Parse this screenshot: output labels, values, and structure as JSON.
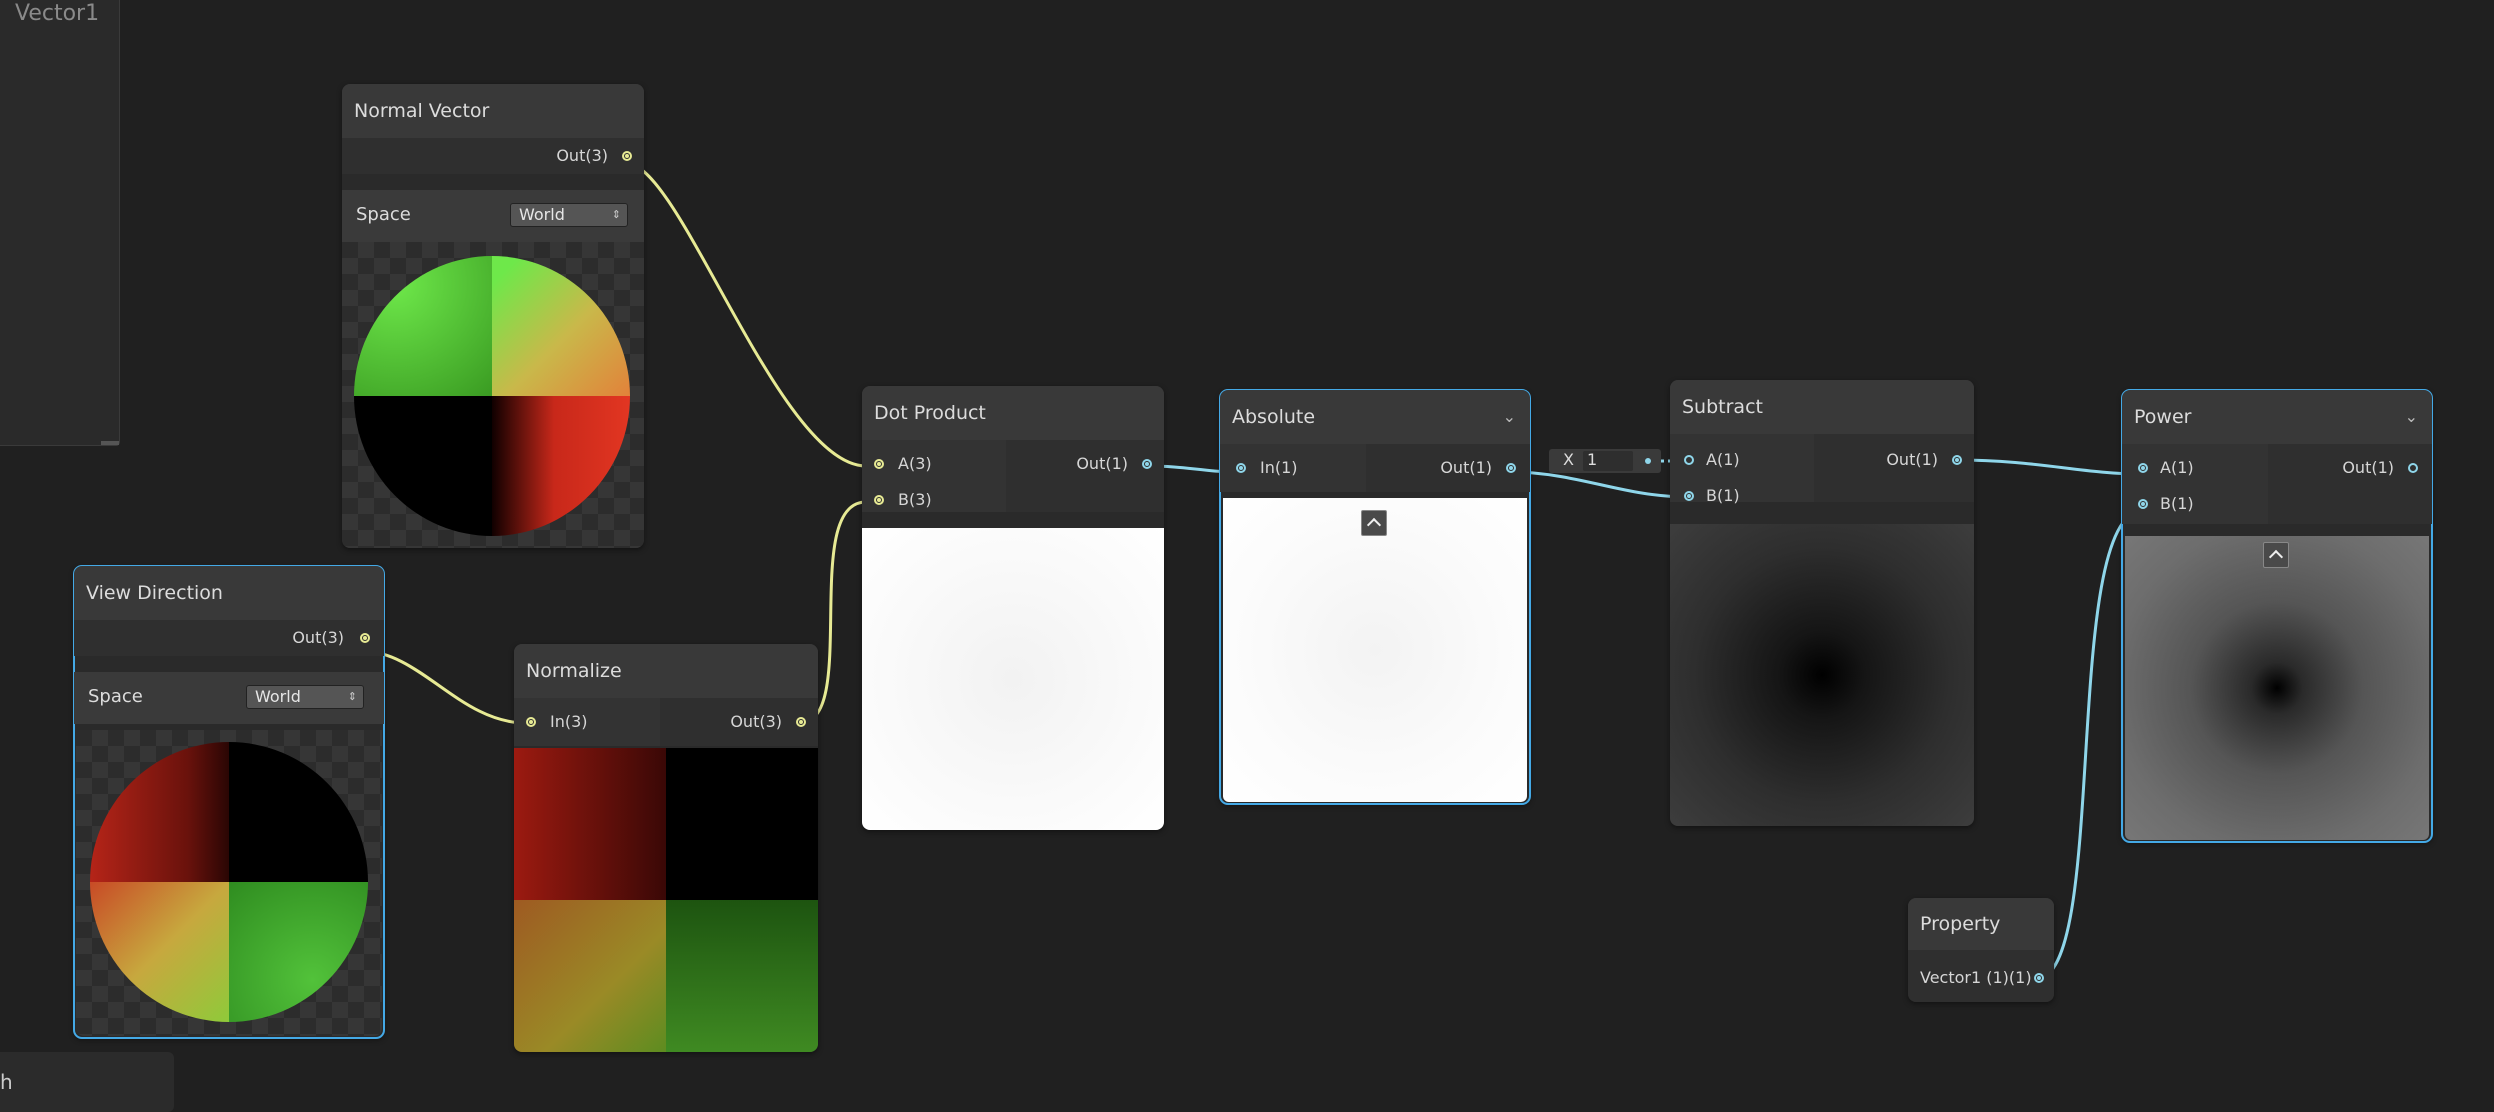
{
  "blackboard": {
    "title": "Vector1"
  },
  "bottom_partial": {
    "label": "h"
  },
  "nodes": {
    "normal_vector": {
      "title": "Normal Vector",
      "out": "Out(3)",
      "space_label": "Space",
      "space_value": "World"
    },
    "view_direction": {
      "title": "View Direction",
      "out": "Out(3)",
      "space_label": "Space",
      "space_value": "World"
    },
    "normalize": {
      "title": "Normalize",
      "in": "In(3)",
      "out": "Out(3)"
    },
    "dot_product": {
      "title": "Dot Product",
      "in_a": "A(3)",
      "in_b": "B(3)",
      "out": "Out(1)"
    },
    "absolute": {
      "title": "Absolute",
      "in": "In(1)",
      "out": "Out(1)"
    },
    "subtract": {
      "title": "Subtract",
      "in_a": "A(1)",
      "in_b": "B(1)",
      "out": "Out(1)",
      "inline_label": "X",
      "inline_value": "1"
    },
    "power": {
      "title": "Power",
      "in_a": "A(1)",
      "in_b": "B(1)",
      "out": "Out(1)"
    },
    "property": {
      "title": "Property",
      "out": "Vector1 (1)(1)"
    }
  },
  "colors": {
    "background": "#202020",
    "wire_vector3": "#e7ea94",
    "wire_vector1": "#8fd6ea",
    "selection": "#44a9e6"
  }
}
